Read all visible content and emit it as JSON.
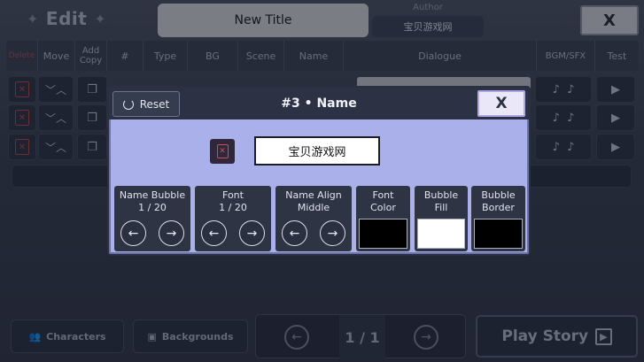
{
  "header": {
    "edit_label": "Edit",
    "title_value": "New Title",
    "author_label": "Author",
    "author_value": "宝贝游戏网",
    "close_label": "X"
  },
  "table": {
    "columns": [
      "Delete",
      "Move",
      "Add Copy",
      "#",
      "Type",
      "BG",
      "Scene",
      "Name",
      "Dialogue",
      "BGM/SFX",
      "Test"
    ]
  },
  "bottom": {
    "characters_label": "Characters",
    "backgrounds_label": "Backgrounds",
    "page_indicator": "1 / 1",
    "play_story_label": "Play Story"
  },
  "modal": {
    "reset_label": "Reset",
    "title": "#3 • Name",
    "close_label": "X",
    "name_value": "宝贝游戏网",
    "options": [
      {
        "label": "Name Bubble",
        "value": "1 / 20"
      },
      {
        "label": "Font",
        "value": "1 / 20"
      },
      {
        "label": "Name Align",
        "value": "Middle"
      }
    ],
    "colors": [
      {
        "label_line1": "Font",
        "label_line2": "Color",
        "color": "#000000"
      },
      {
        "label_line1": "Bubble",
        "label_line2": "Fill",
        "color": "#ffffff"
      },
      {
        "label_line1": "Bubble",
        "label_line2": "Border",
        "color": "#000000"
      }
    ]
  },
  "icons": {
    "prev": "←",
    "next": "→",
    "delete": "✕",
    "up": "︿",
    "down": "﹀",
    "copy": "❐",
    "play": "▶",
    "music": "♪"
  }
}
